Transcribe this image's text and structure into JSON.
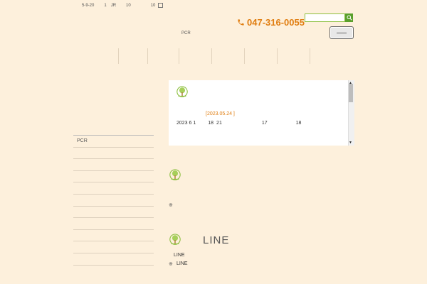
{
  "header": {
    "address_parts": [
      "5-9-20",
      "1",
      "JR",
      "10",
      "10"
    ],
    "phone": "047-316-0055",
    "pcr_label": "PCR"
  },
  "search": {
    "placeholder": ""
  },
  "news": {
    "date": "[2023.05.24 ]",
    "text_parts": [
      "2023 6 1",
      "18",
      "21",
      "17",
      "18"
    ]
  },
  "sidebar": {
    "items": [
      {
        "label": "PCR"
      },
      {
        "label": ""
      },
      {
        "label": ""
      },
      {
        "label": ""
      },
      {
        "label": ""
      },
      {
        "label": ""
      },
      {
        "label": ""
      },
      {
        "label": ""
      },
      {
        "label": ""
      },
      {
        "label": ""
      },
      {
        "label": ""
      }
    ]
  },
  "section2": {
    "note_mark": "※"
  },
  "section3": {
    "title": "LINE",
    "text1": "LINE",
    "note_mark": "※",
    "text2": "LINE"
  },
  "colors": {
    "background": "#fdf0dc",
    "accent_orange": "#e07d10",
    "accent_green": "#5aa02c"
  },
  "icons": [
    "phone-icon",
    "search-icon",
    "tree-icon",
    "menu-icon"
  ]
}
